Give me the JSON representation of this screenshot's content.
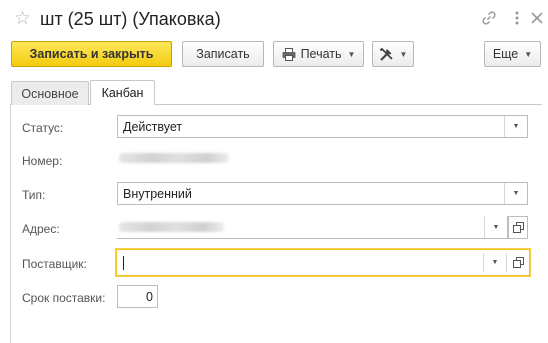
{
  "window": {
    "title": "шт (25 шт) (Упаковка)",
    "icons": {
      "favorite": "star-icon",
      "link": "link-icon",
      "more": "more-vertical-icon",
      "close": "close-icon"
    }
  },
  "toolbar": {
    "save_close_label": "Записать и закрыть",
    "save_label": "Записать",
    "print_label": "Печать",
    "tools_icon": "tools-icon",
    "more_label": "Еще",
    "accent_color": "#f4cb0e"
  },
  "tabs": [
    {
      "label": "Основное",
      "active": false
    },
    {
      "label": "Канбан",
      "active": true
    }
  ],
  "form": {
    "status": {
      "label": "Статус:",
      "value": "Действует"
    },
    "number": {
      "label": "Номер:"
    },
    "type": {
      "label": "Тип:",
      "value": "Внутренний"
    },
    "address": {
      "label": "Адрес:"
    },
    "supplier": {
      "label": "Поставщик:",
      "value": ""
    },
    "lead_time": {
      "label": "Срок поставки:",
      "value": "0"
    }
  }
}
